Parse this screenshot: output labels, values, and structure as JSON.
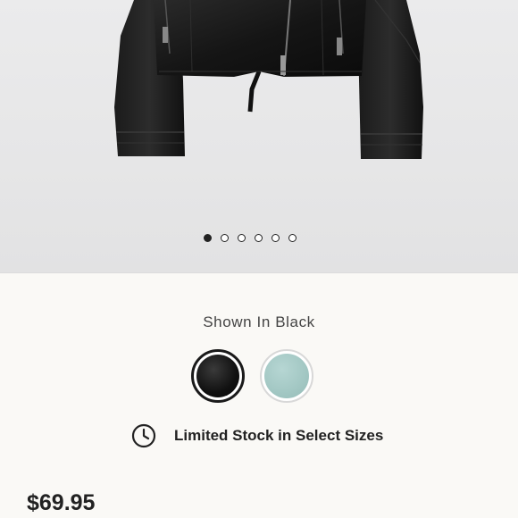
{
  "product": {
    "image_alt": "black-leather-jacket",
    "carousel": {
      "count": 6,
      "active_index": 0
    },
    "color_label": "Shown In Black",
    "swatches": [
      {
        "name": "black",
        "color": "#111111",
        "selected": true
      },
      {
        "name": "mint",
        "color": "#a2c7c3",
        "selected": false
      }
    ],
    "stock_icon": "clock-icon",
    "stock_message": "Limited Stock in Select Sizes",
    "price": "$69.95"
  },
  "colors": {
    "background": "#faf9f6",
    "hero_background": "#e8e8e9",
    "text": "#222222"
  }
}
